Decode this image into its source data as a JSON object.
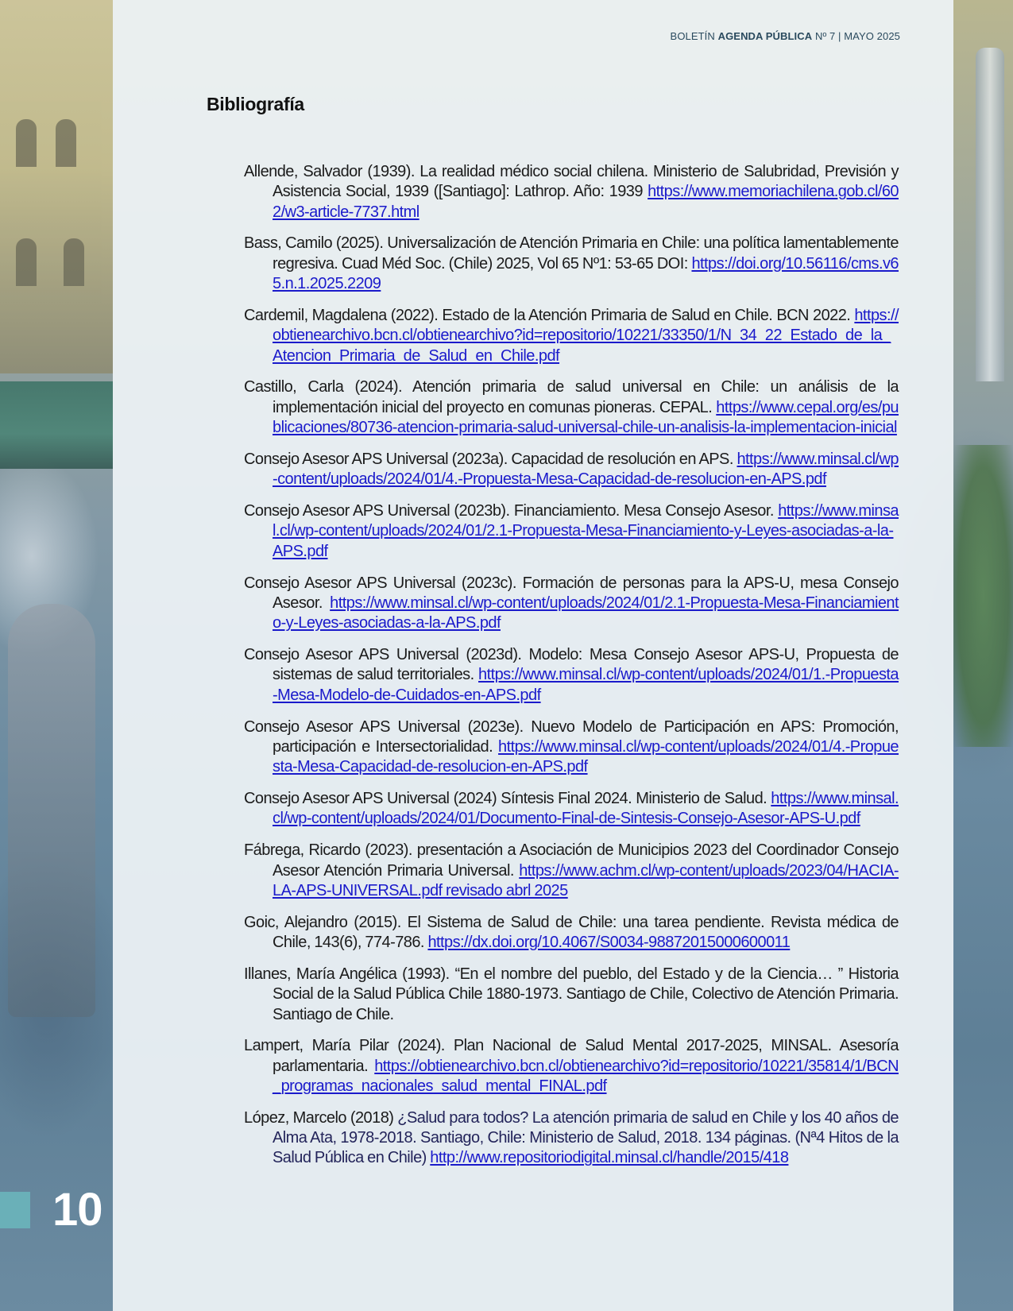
{
  "header": {
    "prefix": "BOLETÍN ",
    "brand": "AGENDA PÚBLICA",
    "issue": " Nº 7  |  MAYO 2025"
  },
  "section_title": "Bibliografía",
  "page_number": "10",
  "references": [
    {
      "text": "Allende, Salvador (1939). La realidad médico social chilena. Ministerio de Salubridad, Previsión y Asistencia Social, 1939 ([Santiago]: Lathrop. Año: 1939 ",
      "link": "https://www.memoriachilena.gob.cl/602/w3-article-7737.html"
    },
    {
      "text": "Bass, Camilo (2025). Universalización de Atención Primaria en Chile: una política lamentablemente regresiva. Cuad Méd Soc. (Chile) 2025, Vol 65 Nº1: 53-65 DOI: ",
      "link": "https://doi.org/10.56116/cms.v65.n.1.2025.2209"
    },
    {
      "text": "Cardemil, Magdalena (2022). Estado de la Atención Primaria de Salud en Chile. BCN 2022. ",
      "link": "https://obtienearchivo.bcn.cl/obtienearchivo?id=repositorio/10221/33350/1/N_34_22_Estado_de_la_Atencion_Primaria_de_Salud_en_Chile.pdf"
    },
    {
      "text": "Castillo, Carla (2024). Atención primaria de salud universal en Chile: un análisis de la implementación inicial del proyecto en comunas pioneras. CEPAL. ",
      "link": "https://www.cepal.org/es/publicaciones/80736-atencion-primaria-salud-universal-chile-un-analisis-la-implementacion-inicial"
    },
    {
      "text": "Consejo Asesor APS Universal (2023a). Capacidad de resolución en APS. ",
      "link": "https://www.minsal.cl/wp-content/uploads/2024/01/4.-Propuesta-Mesa-Capacidad-de-resolucion-en-APS.pdf"
    },
    {
      "text": "Consejo Asesor APS Universal (2023b). Financiamiento. Mesa Consejo Asesor. ",
      "link": "https://www.minsal.cl/wp-content/uploads/2024/01/2.1-Propuesta-Mesa-Financiamiento-y-Leyes-asociadas-a-la-APS.pdf"
    },
    {
      "text": "Consejo Asesor APS Universal (2023c). Formación de personas para la APS-U, mesa Consejo Asesor. ",
      "link": "https://www.minsal.cl/wp-content/uploads/2024/01/2.1-Propuesta-Mesa-Financiamiento-y-Leyes-asociadas-a-la-APS.pdf"
    },
    {
      "text": "Consejo Asesor APS Universal (2023d). Modelo: Mesa Consejo Asesor APS-U, Propuesta de sistemas de salud territoriales. ",
      "link": "https://www.minsal.cl/wp-content/uploads/2024/01/1.-Propuesta-Mesa-Modelo-de-Cuidados-en-APS.pdf"
    },
    {
      "text": "Consejo Asesor APS Universal (2023e). Nuevo Modelo de Participación en APS: Promoción, participación e Intersectorialidad. ",
      "link": "https://www.minsal.cl/wp-content/uploads/2024/01/4.-Propuesta-Mesa-Capacidad-de-resolucion-en-APS.pdf"
    },
    {
      "text": "Consejo Asesor APS Universal (2024) Síntesis Final 2024. Ministerio de Salud. ",
      "link": "https://www.minsal.cl/wp-content/uploads/2024/01/Documento-Final-de-Sintesis-Consejo-Asesor-APS-U.pdf"
    },
    {
      "text": "Fábrega, Ricardo (2023). presentación a Asociación de Municipios 2023 del Coordinador Consejo Asesor Atención Primaria Universal. ",
      "link": "https://www.achm.cl/wp-content/uploads/2023/04/HACIA-LA-APS-UNIVERSAL.pdf revisado abrl 2025"
    },
    {
      "text": "Goic, Alejandro (2015). El Sistema de Salud de Chile: una tarea pendiente. Revista médica de Chile, 143(6), 774-786. ",
      "link": "https://dx.doi.org/10.4067/S0034-98872015000600011"
    },
    {
      "text": "Illanes, María Angélica (1993). “En el nombre del pueblo, del Estado y de la Ciencia… ” Historia Social de la Salud Pública Chile 1880-1973. Santiago de Chile,  Colectivo de Atención Primaria. Santiago de Chile.",
      "link": ""
    },
    {
      "text": "Lampert, María Pilar (2024). Plan Nacional de Salud Mental 2017-2025, MINSAL. Asesoría parlamentaria. ",
      "link": "https://obtienearchivo.bcn.cl/obtienearchivo?id=repositorio/10221/35814/1/BCN_programas_nacionales_salud_mental_FINAL.pdf"
    },
    {
      "text": "López, Marcelo (2018) ",
      "highlight": "¿Salud para todos? La atención primaria de salud en Chile y los 40 años de Alma Ata, 1978-2018. Santiago, Chile: Ministerio de Salud, 2018. 134 páginas. (Nª4 Hitos de la Salud Pública en Chile)",
      "link": "http://www.repositoriodigital.minsal.cl/handle/2015/418"
    }
  ]
}
